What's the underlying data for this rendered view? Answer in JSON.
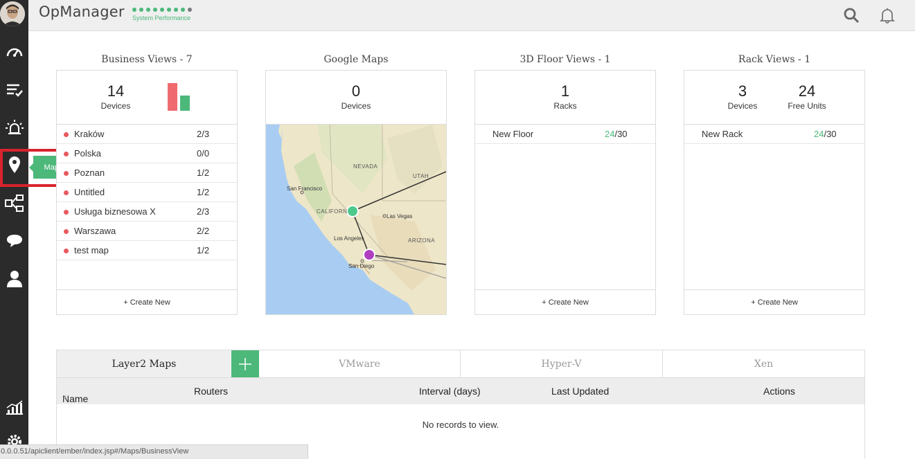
{
  "header": {
    "app_title": "OpManager",
    "perf_label": "System Performance",
    "perf_dots_green": 8,
    "perf_dots_grey": 1
  },
  "sidebar": {
    "tooltip": "Maps",
    "items": [
      {
        "icon": "dashboard-icon"
      },
      {
        "icon": "inventory-icon"
      },
      {
        "icon": "alarms-icon"
      },
      {
        "icon": "map-pin-icon"
      },
      {
        "icon": "workflow-icon"
      },
      {
        "icon": "chat-icon"
      },
      {
        "icon": "user-icon"
      },
      {
        "icon": "reports-icon"
      },
      {
        "icon": "settings-icon"
      }
    ]
  },
  "business_views": {
    "title": "Business Views - 7",
    "count": "14",
    "count_label": "Devices",
    "rows": [
      {
        "name": "Kraków",
        "value": "2/3"
      },
      {
        "name": "Polska",
        "value": "0/0"
      },
      {
        "name": "Poznan",
        "value": "1/2"
      },
      {
        "name": "Untitled",
        "value": "1/2"
      },
      {
        "name": "Usługa biznesowa X",
        "value": "2/3"
      },
      {
        "name": "Warszawa",
        "value": "2/2"
      },
      {
        "name": "test map",
        "value": "1/2"
      }
    ],
    "create_new": "+ Create New",
    "mini_bars": [
      {
        "color": "#ef6b6f"
      },
      {
        "color": "#4cb87a"
      }
    ]
  },
  "google_maps": {
    "title": "Google Maps",
    "count": "0",
    "count_label": "Devices",
    "map_labels": {
      "nevada": "NEVADA",
      "utah": "UTAH",
      "san_francisco": "San Francisco",
      "california": "CALIFORN",
      "las_vegas": "Las Vegas",
      "los_angeles": "Los Angeles",
      "arizona": "ARIZONA",
      "san_diego": "San Diego"
    },
    "marker_colors": [
      "#4cc98a",
      "#b03fc0"
    ]
  },
  "floor_views": {
    "title": "3D Floor Views - 1",
    "count": "1",
    "count_label": "Racks",
    "rows": [
      {
        "name": "New Floor",
        "used": "24",
        "total": "/30"
      }
    ],
    "create_new": "+ Create New"
  },
  "rack_views": {
    "title": "Rack Views - 1",
    "devices_count": "3",
    "devices_label": "Devices",
    "free_units": "24",
    "free_units_label": "Free Units",
    "rows": [
      {
        "name": "New Rack",
        "used": "24",
        "total": "/30"
      }
    ],
    "create_new": "+ Create New"
  },
  "layer2": {
    "tabs": [
      "Layer2 Maps",
      "VMware",
      "Hyper-V",
      "Xen"
    ],
    "columns": [
      "Name",
      "Routers",
      "Interval (days)",
      "Last Updated",
      "Actions"
    ],
    "empty_text": "No records to view."
  },
  "status_url": "0.0.0.51/apiclient/ember/index.jsp#/Maps/BusinessView"
}
